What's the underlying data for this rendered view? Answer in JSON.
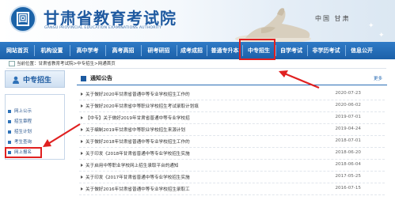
{
  "header": {
    "title": "甘肃省教育考试院",
    "subtitle": "GANSU PROVINCIAL EDUCATION EXAMINATIONS AUTHORITY",
    "region": "中国 甘肃",
    "logo_glyph": "回"
  },
  "nav": {
    "items": [
      {
        "label": "网站首页"
      },
      {
        "label": "机构设置"
      },
      {
        "label": "高中学考"
      },
      {
        "label": "高考高招"
      },
      {
        "label": "研考研招"
      },
      {
        "label": "成考成招"
      },
      {
        "label": "普通专升本"
      },
      {
        "label": "中专招生"
      },
      {
        "label": "自学考试"
      },
      {
        "label": "非学历考试"
      },
      {
        "label": "信息公开"
      }
    ],
    "active_index": 7
  },
  "breadcrumb": {
    "text": "当前位置：甘肃省教育考试院>中专招生>网通首页"
  },
  "sidebar": {
    "title": "中专招生",
    "items": [
      {
        "label": "网上公示"
      },
      {
        "label": "招生章程"
      },
      {
        "label": "招生计划"
      },
      {
        "label": "考生查询"
      },
      {
        "label": "网上报名"
      }
    ],
    "highlight_index": 4
  },
  "notices": {
    "heading": "通知公告",
    "more": "更多",
    "rows": [
      {
        "title": "关于做好2020年甘肃省普通中等专业学校招生工作的",
        "date": "2020-07-23"
      },
      {
        "title": "关于做好2020年甘肃省中等职业学校招生考试录取计划填",
        "date": "2020-06-02"
      },
      {
        "title": "【中专】关于做好2019年甘肃省普通中等专业学校招",
        "date": "2019-07-01"
      },
      {
        "title": "关于编制2019年甘肃省中等职业学校招生来源计划",
        "date": "2019-04-24"
      },
      {
        "title": "关于做好2018年甘肃省普通中等专业学校招生工作的",
        "date": "2018-07-01"
      },
      {
        "title": "关于印发《2018年甘肃省普通中等专业学校招生实施",
        "date": "2018-06-20"
      },
      {
        "title": "关于启用中等职业学校网上招生录取平台的通知",
        "date": "2018-06-04"
      },
      {
        "title": "关于印发《2017年甘肃省普通中等专业学校招生实施",
        "date": "2017-05-25"
      },
      {
        "title": "关于做好2016年甘肃省普通中等专业学校招生录取工",
        "date": "2016-07-15"
      }
    ]
  },
  "colors": {
    "brand_blue": "#1f5aa0",
    "nav_blue": "#2a6db5",
    "annotation_red": "#e02020"
  }
}
